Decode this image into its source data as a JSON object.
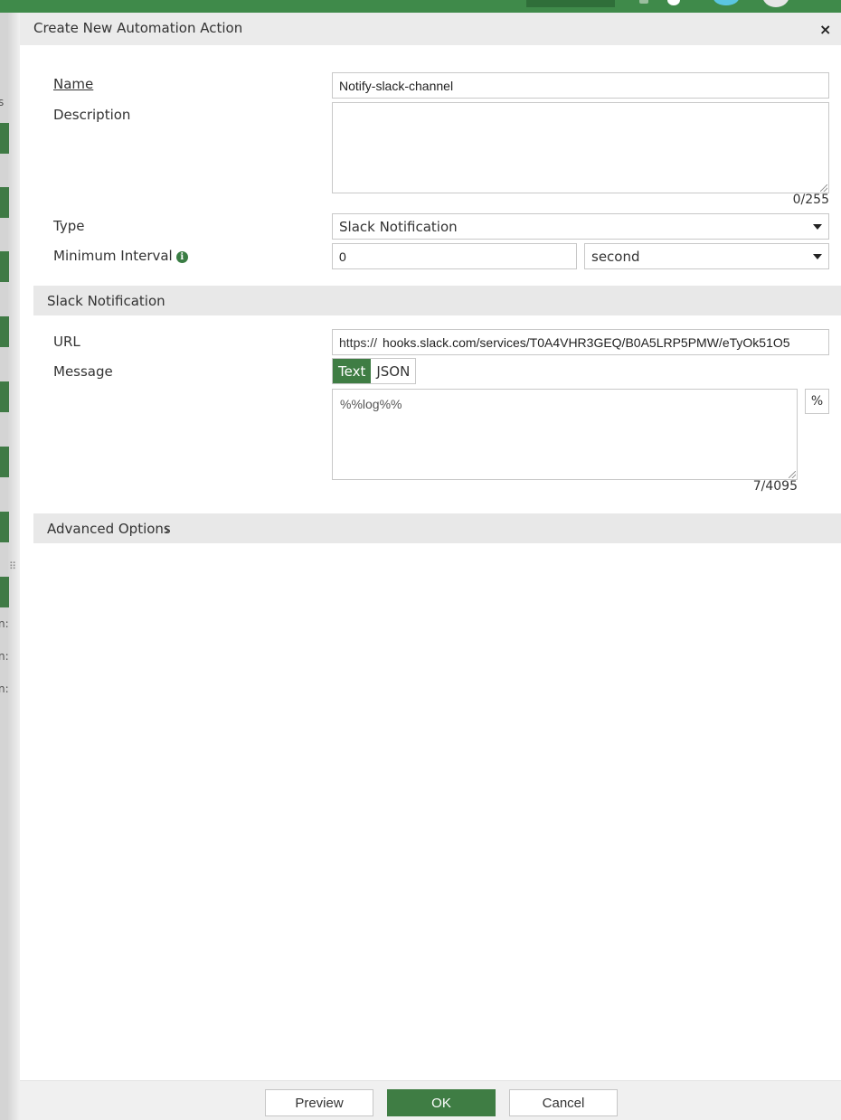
{
  "dialog": {
    "title": "Create New Automation Action",
    "close_icon": "×"
  },
  "form": {
    "name_label": "Name",
    "name_value": "Notify-slack-channel",
    "description_label": "Description",
    "description_value": "",
    "description_counter": "0/255",
    "type_label": "Type",
    "type_value": "Slack Notification",
    "min_interval_label": "Minimum Interval",
    "min_interval_info_icon": "i",
    "min_interval_value": "0",
    "min_interval_unit": "second"
  },
  "slack_section": {
    "title": "Slack Notification",
    "url_label": "URL",
    "url_prefix": "https://",
    "url_value": "hooks.slack.com/services/T0A4VHR3GEQ/B0A5LRP5PMW/eTyOk51O5",
    "message_label": "Message",
    "format_options": [
      "Text",
      "JSON"
    ],
    "format_selected": "Text",
    "message_value": "%%log%%",
    "message_counter": "7/4095",
    "insert_variable_button": "%"
  },
  "advanced": {
    "title": "Advanced Options",
    "chevron": "›"
  },
  "footer": {
    "preview_label": "Preview",
    "ok_label": "OK",
    "cancel_label": "Cancel"
  },
  "background": {
    "side_fragments": [
      "s",
      "n:",
      "n:",
      "n:"
    ]
  },
  "colors": {
    "accent": "#3f7d44",
    "header_bar": "#3f8a4a"
  }
}
